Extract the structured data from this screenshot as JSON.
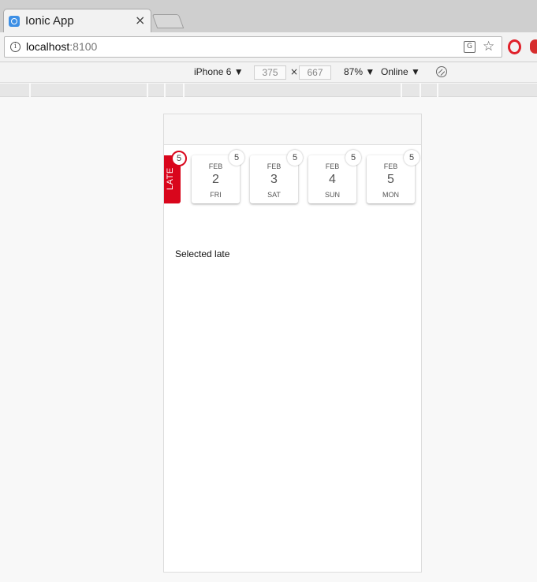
{
  "browser": {
    "tab_title": "Ionic App",
    "tab_close": "×",
    "url_host": "localhost",
    "url_port": ":8100"
  },
  "devtools": {
    "device": "iPhone 6 ▼",
    "width": "375",
    "height": "667",
    "times": "×",
    "zoom": "87% ▼",
    "network": "Online ▼"
  },
  "app": {
    "late": {
      "label": "LATE",
      "count": "5"
    },
    "days": [
      {
        "month": "FEB",
        "day": "2",
        "weekday": "FRI",
        "count": "5"
      },
      {
        "month": "FEB",
        "day": "3",
        "weekday": "SAT",
        "count": "5"
      },
      {
        "month": "FEB",
        "day": "4",
        "weekday": "SUN",
        "count": "5"
      },
      {
        "month": "FEB",
        "day": "5",
        "weekday": "MON",
        "count": "5"
      }
    ],
    "selected_text": "Selected late"
  },
  "colors": {
    "accent": "#d9061c",
    "favicon": "#3d8fe5"
  }
}
